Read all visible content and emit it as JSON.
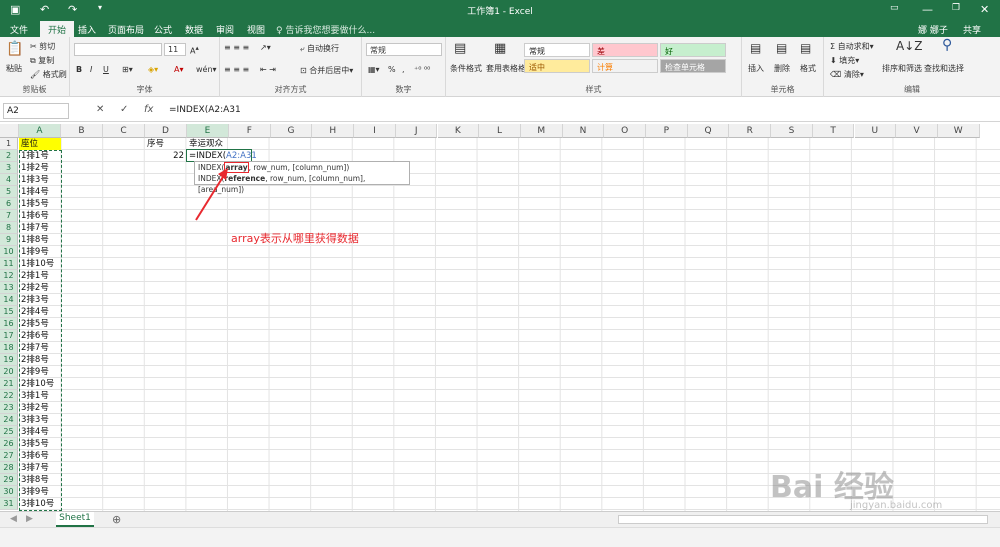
{
  "window": {
    "title": "工作簿1 - Excel",
    "user": "娜 娜子",
    "share": "共享"
  },
  "ribbon_tabs": [
    "文件",
    "开始",
    "插入",
    "页面布局",
    "公式",
    "数据",
    "审阅",
    "视图"
  ],
  "tell_me": "告诉我您想要做什么...",
  "clipboard": {
    "label": "剪贴板",
    "paste": "粘贴",
    "cut": "剪切",
    "copy": "复制",
    "format_painter": "格式刷"
  },
  "font": {
    "label": "字体",
    "size": "11",
    "bold": "B",
    "italic": "I",
    "underline": "U"
  },
  "alignment": {
    "label": "对齐方式",
    "wrap": "自动换行",
    "merge": "合并后居中"
  },
  "number": {
    "label": "数字",
    "format": "常规",
    "percent": "%"
  },
  "styles": {
    "label": "样式",
    "conditional": "条件格式",
    "table": "套用表格格式",
    "cells": [
      "常规",
      "差",
      "好",
      "适中",
      "计算",
      "检查单元格"
    ]
  },
  "cells_group": {
    "label": "单元格",
    "insert": "插入",
    "delete": "删除",
    "format": "格式"
  },
  "editing": {
    "label": "编辑",
    "autosum": "自动求和",
    "fill": "填充",
    "clear": "清除",
    "sort": "排序和筛选",
    "find": "查找和选择"
  },
  "formula_bar": {
    "name_box": "A2",
    "fx": "fx",
    "cancel": "✕",
    "enter": "✓",
    "content": "=INDEX(A2:A31"
  },
  "columns": [
    "A",
    "B",
    "C",
    "D",
    "E",
    "F",
    "G",
    "H",
    "I",
    "J",
    "K",
    "L",
    "M",
    "N",
    "O",
    "P",
    "Q",
    "R",
    "S",
    "T",
    "U",
    "V",
    "W"
  ],
  "rows": [
    "1",
    "2",
    "3",
    "4",
    "5",
    "6",
    "7",
    "8",
    "9",
    "10",
    "11",
    "12",
    "13",
    "14",
    "15",
    "16",
    "17",
    "18",
    "19",
    "20",
    "21",
    "22",
    "23",
    "24",
    "25",
    "26",
    "27",
    "28",
    "29",
    "30",
    "31"
  ],
  "colA": [
    "座位",
    "1排1号",
    "1排2号",
    "1排3号",
    "1排4号",
    "1排5号",
    "1排6号",
    "1排7号",
    "1排8号",
    "1排9号",
    "1排10号",
    "2排1号",
    "2排2号",
    "2排3号",
    "2排4号",
    "2排5号",
    "2排6号",
    "2排7号",
    "2排8号",
    "2排9号",
    "2排10号",
    "3排1号",
    "3排2号",
    "3排3号",
    "3排4号",
    "3排5号",
    "3排6号",
    "3排7号",
    "3排8号",
    "3排9号",
    "3排10号"
  ],
  "d1": "序号",
  "e1": "幸运观众",
  "d2": "22",
  "e2_prefix": "=INDEX(",
  "e2_ref": "A2:A31",
  "tooltip": {
    "line1_fn": "INDEX(",
    "line1_arg": "array",
    "line1_rest": ", row_num, [column_num])",
    "line2_fn": "INDEX(",
    "line2_arg": "reference",
    "line2_rest": ", row_num, [column_num], [area_num])"
  },
  "annotation": "array表示从哪里获得数据",
  "sheet_tab": "Sheet1",
  "add_sheet": "⊕",
  "watermark": "Bai 经验",
  "watermark_url": "jingyan.baidu.com",
  "colors": {
    "accent": "#217346",
    "annotation": "#e8292f",
    "a1_fill": "#ffff00"
  }
}
